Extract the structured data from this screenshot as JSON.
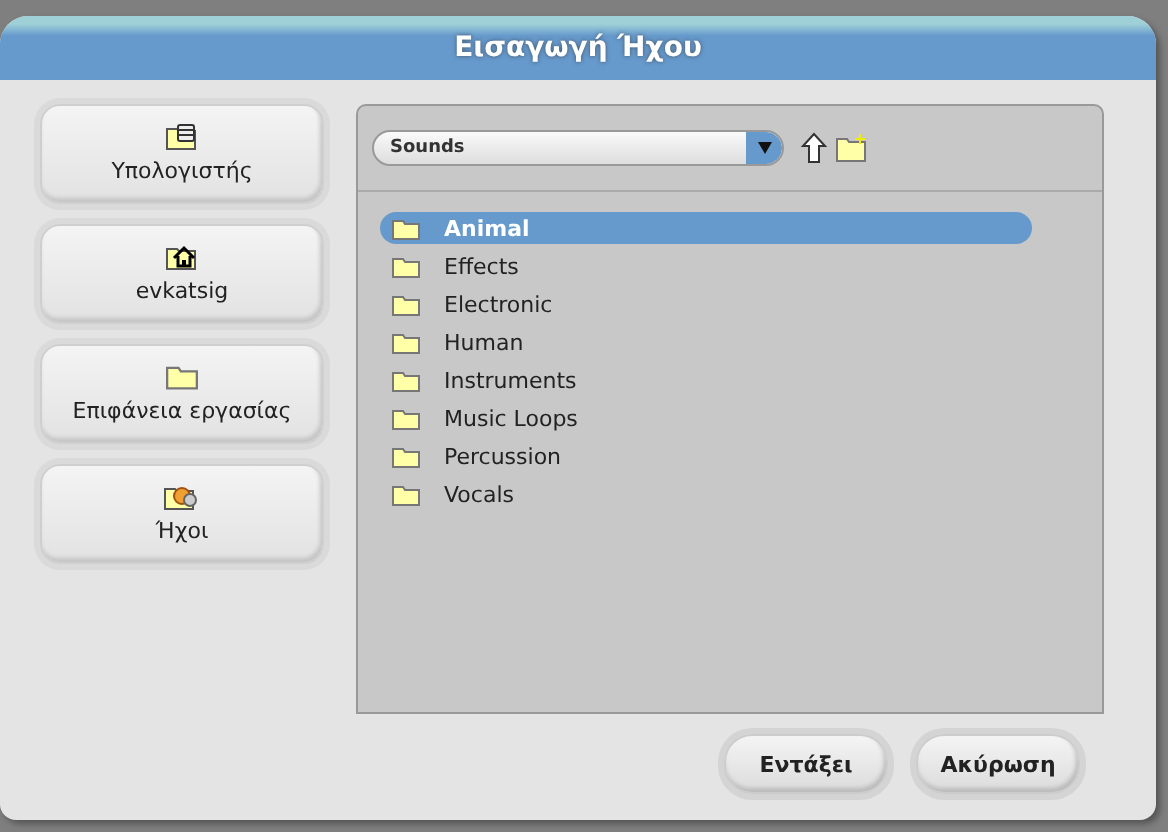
{
  "window": {
    "title": "Εισαγωγή Ήχου"
  },
  "sidebar": {
    "items": [
      {
        "label": "Υπολογιστής",
        "kind": "computer"
      },
      {
        "label": "evkatsig",
        "kind": "home"
      },
      {
        "label": "Επιφάνεια εργασίας",
        "kind": "folder"
      },
      {
        "label": "Ήχοι",
        "kind": "sounds"
      }
    ]
  },
  "location": {
    "value": "Sounds"
  },
  "files": [
    {
      "name": "Animal",
      "selected": true
    },
    {
      "name": "Effects",
      "selected": false
    },
    {
      "name": "Electronic",
      "selected": false
    },
    {
      "name": "Human",
      "selected": false
    },
    {
      "name": "Instruments",
      "selected": false
    },
    {
      "name": "Music Loops",
      "selected": false
    },
    {
      "name": "Percussion",
      "selected": false
    },
    {
      "name": "Vocals",
      "selected": false
    }
  ],
  "buttons": [
    "Εντάξει",
    "Ακύρωση"
  ]
}
